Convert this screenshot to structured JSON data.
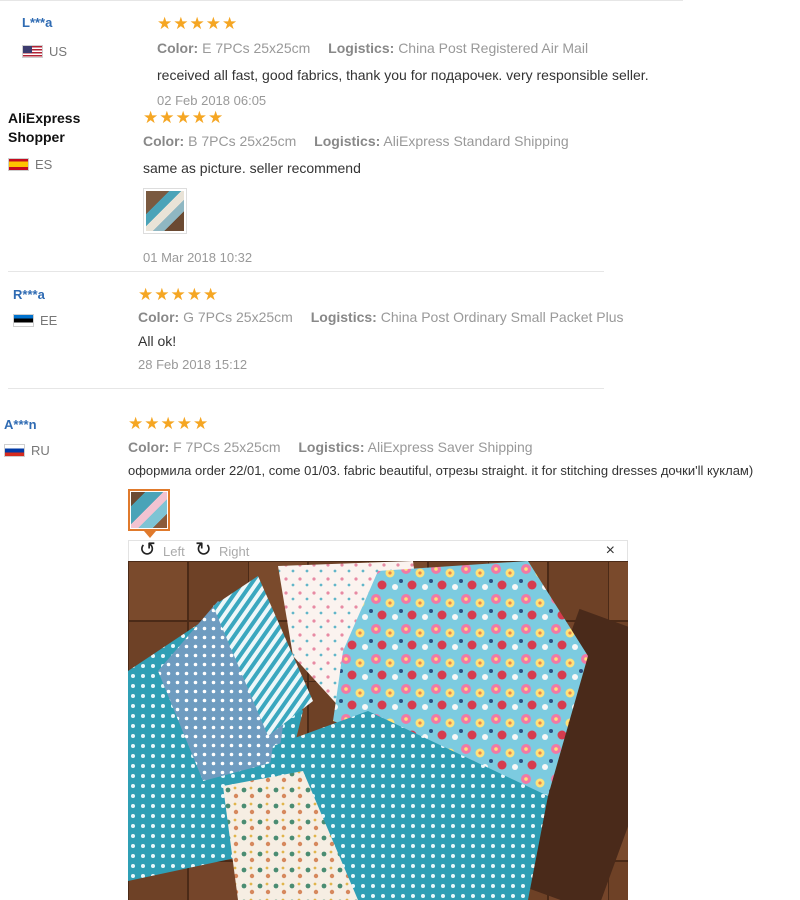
{
  "reviews": [
    {
      "name": "L***a",
      "country": "US",
      "stars": "★★★★★",
      "color_label": "Color:",
      "color_value": "E 7PCs 25x25cm",
      "logistics_label": "Logistics:",
      "logistics_value": "China Post Registered Air Mail",
      "text": "received all fast, good fabrics, thank you for подарочек. very responsible seller.",
      "date": "02 Feb 2018 06:05"
    },
    {
      "name": "AliExpress Shopper",
      "country": "ES",
      "stars": "★★★★★",
      "color_label": "Color:",
      "color_value": "B 7PCs 25x25cm",
      "logistics_label": "Logistics:",
      "logistics_value": "AliExpress Standard Shipping",
      "text": "same as picture. seller recommend",
      "date": "01 Mar 2018 10:32"
    },
    {
      "name": "R***a",
      "country": "EE",
      "stars": "★★★★★",
      "color_label": "Color:",
      "color_value": "G 7PCs 25x25cm",
      "logistics_label": "Logistics:",
      "logistics_value": "China Post Ordinary Small Packet Plus",
      "text": "All ok!",
      "date": "28 Feb 2018 15:12"
    },
    {
      "name": "A***n",
      "country": "RU",
      "stars": "★★★★★",
      "color_label": "Color:",
      "color_value": "F 7PCs 25x25cm",
      "logistics_label": "Logistics:",
      "logistics_value": "AliExpress Saver Shipping",
      "text": "оформила order 22/01, come 01/03. fabric beautiful, отрезы straight. it for stitching dresses дочки'll куклам)"
    }
  ],
  "viewer": {
    "rotate_left": "Left",
    "rotate_right": "Right",
    "close": "×"
  },
  "colors": {
    "star": "#f5a623",
    "name_link": "#2f6bb3"
  }
}
